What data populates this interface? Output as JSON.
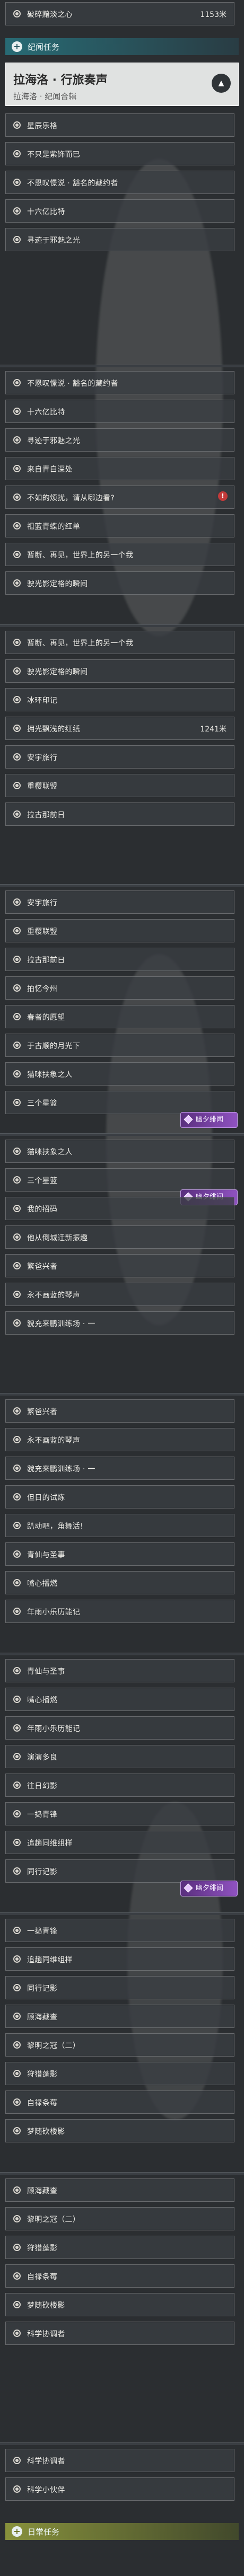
{
  "top_row": {
    "label": "破碎黯淡之心",
    "distance": "1153米"
  },
  "sections": {
    "story": "纪闻任务",
    "daily": "日常任务"
  },
  "expanded": {
    "title": "拉海洛 · 行旅奏声",
    "subtitle": "拉海洛 · 纪闻合辑"
  },
  "badge_label": "幽夕绯闻",
  "blocks": [
    {
      "rows": [
        "星辰乐格",
        "不只是紫饰而已",
        "不恩叹憬说 · 豁名的藏约者",
        "十六亿比特",
        "寻迹于邪魅之光"
      ]
    },
    {
      "rows": [
        "不恩叹憬说 · 豁名的藏约者",
        "十六亿比特",
        "寻迹于邪魅之光",
        "来自青白深处",
        "不如的烦扰，请从哪边看?",
        "祖蓝青蝶的红单",
        "暂断、再见，世界上的另一个我",
        "驶光影定格的瞬间"
      ],
      "alert_index": 4
    },
    {
      "rows": [
        "暂断、再见，世界上的另一个我",
        "驶光影定格的瞬间",
        "冰环印记",
        "拥光飘浅的红纸",
        "安宇旅行",
        "重樱联盟",
        "拉古那前日"
      ],
      "distance_index": 3,
      "distance": "1241米"
    },
    {
      "rows": [
        "安宇旅行",
        "重樱联盟",
        "拉古那前日",
        "拍忆今州",
        "春者的愿望",
        "于古顺的月光下",
        "猫咪扶象之人",
        "三个星篮"
      ],
      "badge_index": 7
    },
    {
      "rows": [
        "猫咪扶象之人",
        "三个星篮",
        "我的招码",
        "他从倒城迁新振趣",
        "繁爸兴者",
        "永不画蓝的琴声",
        "貌充来鹏训练场 · 一"
      ],
      "badge_index": 1
    },
    {
      "rows": [
        "繁爸兴者",
        "永不画蓝的琴声",
        "貌充来鹏训练场 · 一",
        "但日的试炼",
        "趴动吧，角舞活!",
        "青仙与圣事",
        "嘴心播燃",
        "年雨小乐历能记"
      ]
    },
    {
      "rows": [
        "青仙与圣事",
        "嘴心播燃",
        "年雨小乐历能记",
        "演演多良",
        "往日幻影",
        "一捣青锋",
        "追趟同维组样",
        "同行记影"
      ],
      "badge_index": 7
    },
    {
      "rows": [
        "一捣青锋",
        "追趟同维组样",
        "同行记影",
        "顾海藏查",
        "黎明之冠（二）",
        "狩猎蓬影",
        "自禄条莓",
        "梦随砍楼影"
      ]
    },
    {
      "rows": [
        "顾海藏查",
        "黎明之冠（二）",
        "狩猎蓬影",
        "自禄条莓",
        "梦随砍楼影",
        "科学协调者"
      ]
    },
    {
      "rows": [
        "科学协调者",
        "科学小伙伴"
      ]
    }
  ]
}
